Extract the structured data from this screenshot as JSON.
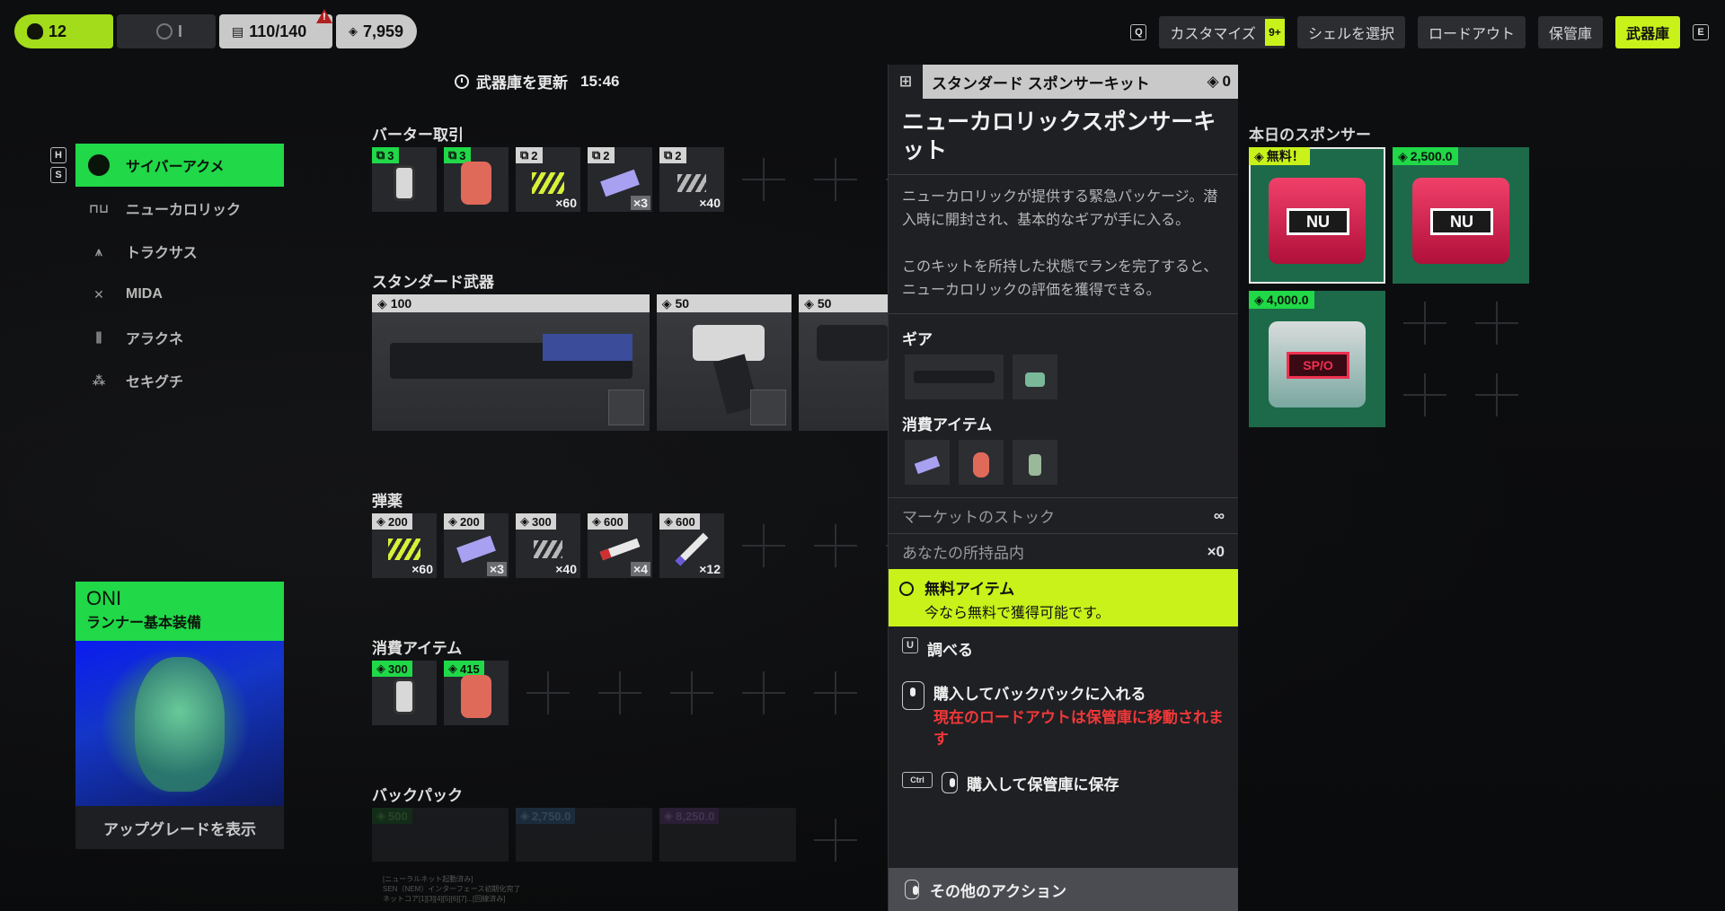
{
  "topbar": {
    "level": "12",
    "squad": "I",
    "backpack": "110/140",
    "currency": "7,959"
  },
  "topnav": {
    "key_left": "Q",
    "customize": "カスタマイズ",
    "customize_badge": "9+",
    "select_shell": "シェルを選択",
    "loadout": "ロードアウト",
    "vault": "保管庫",
    "armory": "武器庫",
    "key_right": "E"
  },
  "refresh": {
    "label": "武器庫を更新",
    "time": "15:46"
  },
  "hotkeys": {
    "h": "H",
    "s": "S"
  },
  "sidebar": {
    "items": [
      {
        "label": "サイバーアクメ",
        "icon": "cyberacme-icon",
        "active": true
      },
      {
        "label": "ニューカロリック",
        "icon": "nucaloric-icon",
        "active": false
      },
      {
        "label": "トラクサス",
        "icon": "traxus-icon",
        "active": false
      },
      {
        "label": "MIDA",
        "icon": "mida-icon",
        "active": false
      },
      {
        "label": "アラクネ",
        "icon": "arachne-icon",
        "active": false
      },
      {
        "label": "セキグチ",
        "icon": "sekiguchi-icon",
        "active": false
      }
    ]
  },
  "runner": {
    "name": "ONI",
    "subtitle": "ランナー基本装備",
    "upgrade": "アップグレードを表示"
  },
  "sections": {
    "barter": "バーター取引",
    "standard_weapons": "スタンダード武器",
    "ammo": "弾薬",
    "consumables": "消費アイテム",
    "backpack": "バックパック"
  },
  "barter_items": [
    {
      "price": "3",
      "qty": ""
    },
    {
      "price": "3",
      "qty": ""
    },
    {
      "price": "2",
      "qty": "×60"
    },
    {
      "price": "2",
      "qty": "×3"
    },
    {
      "price": "2",
      "qty": "×40"
    }
  ],
  "weapons": [
    {
      "price": "100"
    },
    {
      "price": "50"
    },
    {
      "price": "50"
    }
  ],
  "ammo_items": [
    {
      "price": "200",
      "qty": "×60"
    },
    {
      "price": "200",
      "qty": "×3"
    },
    {
      "price": "300",
      "qty": "×40"
    },
    {
      "price": "600",
      "qty": "×4"
    },
    {
      "price": "600",
      "qty": "×12"
    }
  ],
  "consumable_items": [
    {
      "price": "300"
    },
    {
      "price": "415"
    }
  ],
  "backpack_items": [
    {
      "price": "500"
    },
    {
      "price": "2,750.0"
    },
    {
      "price": "8,250.0"
    }
  ],
  "panel": {
    "header": "スタンダード スポンサーキット",
    "header_price": "0",
    "title": "ニューカロリックスポンサーキット",
    "desc1": "ニューカロリックが提供する緊急パッケージ。潜入時に開封され、基本的なギアが手に入る。",
    "desc2": "このキットを所持した状態でランを完了すると、ニューカロリックの評価を獲得できる。",
    "gear_label": "ギア",
    "consumables_label": "消費アイテム",
    "stock_label": "マーケットのストック",
    "stock_value": "∞",
    "owned_label": "あなたの所持品内",
    "owned_value": "×0",
    "free_title": "無料アイテム",
    "free_sub": "今なら無料で獲得可能です。",
    "inspect_key": "U",
    "inspect": "調べる",
    "buy_backpack": "購入してバックパックに入れる",
    "buy_warning": "現在のロードアウトは保管庫に移動されます",
    "buy_vault_key": "Ctrl",
    "buy_vault": "購入して保管庫に保存",
    "more": "その他のアクション"
  },
  "sponsors": {
    "title": "本日のスポンサー",
    "items": [
      {
        "price": "無料！",
        "label": "NU"
      },
      {
        "price": "2,500.0",
        "label": "NU"
      },
      {
        "price": "4,000.0",
        "label": "SP/O"
      }
    ]
  },
  "footnote": [
    "[ニューラルネット起動済み]",
    "SEN（NEM）インターフェース初期化完了",
    "ネットコア[1][3][4][5][6][7]...[回線済み]"
  ],
  "colors": {
    "accent_lime": "#c8f21a",
    "accent_green": "#20d848",
    "warning_red": "#f03838"
  }
}
